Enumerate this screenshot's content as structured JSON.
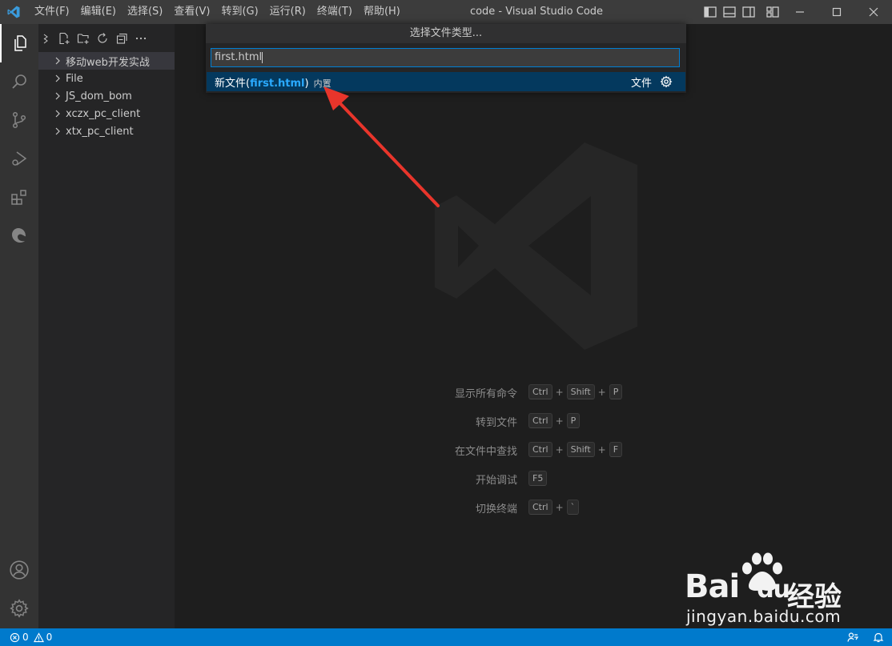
{
  "titlebar": {
    "title": "code - Visual Studio Code",
    "menu": [
      "文件(F)",
      "编辑(E)",
      "选择(S)",
      "查看(V)",
      "转到(G)",
      "运行(R)",
      "终端(T)",
      "帮助(H)"
    ]
  },
  "activity_bar": {
    "top": [
      "explorer-icon",
      "search-icon",
      "source-control-icon",
      "run-debug-icon",
      "extensions-icon",
      "edge-icon"
    ],
    "bottom": [
      "account-icon",
      "settings-gear-icon"
    ]
  },
  "explorer": {
    "toolbar": [
      "new-file-icon",
      "new-folder-icon",
      "refresh-icon",
      "collapse-all-icon",
      "more-icon"
    ],
    "items": [
      {
        "label": "移动web开发实战",
        "selected": true
      },
      {
        "label": "File"
      },
      {
        "label": "JS_dom_bom"
      },
      {
        "label": "xczx_pc_client"
      },
      {
        "label": "xtx_pc_client"
      }
    ]
  },
  "quick_pick": {
    "title": "选择文件类型...",
    "input_value": "first.html",
    "item": {
      "prefix": "新文件(",
      "highlight": "first.html",
      "suffix": ")",
      "description": "内置",
      "kind": "文件"
    }
  },
  "shortcuts": [
    {
      "label": "显示所有命令",
      "keys": [
        "Ctrl",
        "Shift",
        "P"
      ]
    },
    {
      "label": "转到文件",
      "keys": [
        "Ctrl",
        "P"
      ]
    },
    {
      "label": "在文件中查找",
      "keys": [
        "Ctrl",
        "Shift",
        "F"
      ]
    },
    {
      "label": "开始调试",
      "keys": [
        "F5"
      ]
    },
    {
      "label": "切换终端",
      "keys": [
        "Ctrl",
        "`"
      ]
    }
  ],
  "status_bar": {
    "errors": "0",
    "warnings": "0"
  },
  "watermark": {
    "brand": "Bai",
    "brand2": "du",
    "jingyan": "经验",
    "url": "jingyan.baidu.com"
  },
  "colors": {
    "accent": "#007acc",
    "highlight": "#2aaaff",
    "arrow": "#e8352b"
  }
}
